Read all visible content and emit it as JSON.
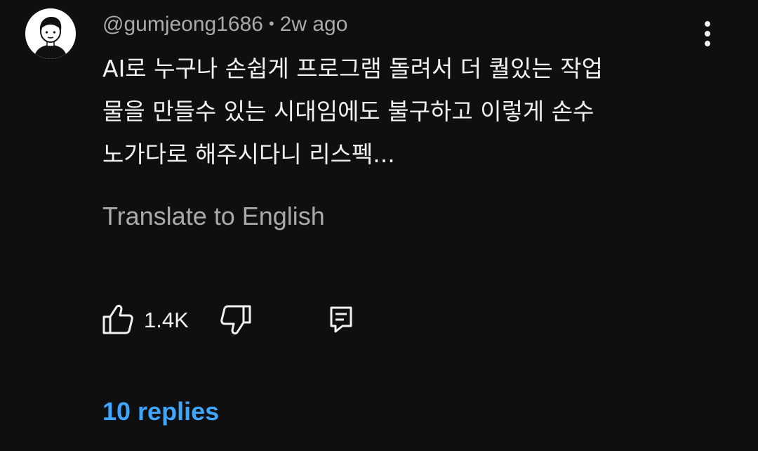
{
  "comment": {
    "author": "@gumjeong1686",
    "separator": "•",
    "time": "2w ago",
    "text": "AI로 누구나 손쉽게 프로그램 돌려서 더 퀄있는 작업\n물을 만들수 있는 시대임에도 불구하고 이렇게 손수\n노가다로 해주시다니 리스펙...",
    "translate_label": "Translate to English",
    "like_count": "1.4K",
    "replies_label": "10 replies"
  },
  "icons": {
    "avatar": "cartoon-person-avatar",
    "menu": "three-dots-vertical-icon",
    "like": "thumbs-up-icon",
    "dislike": "thumbs-down-icon",
    "reply": "comment-reply-icon"
  },
  "colors": {
    "background": "#0f0f0f",
    "text_primary": "#f1f1f1",
    "text_secondary": "#aaaaaa",
    "link_blue": "#3ea6ff"
  }
}
